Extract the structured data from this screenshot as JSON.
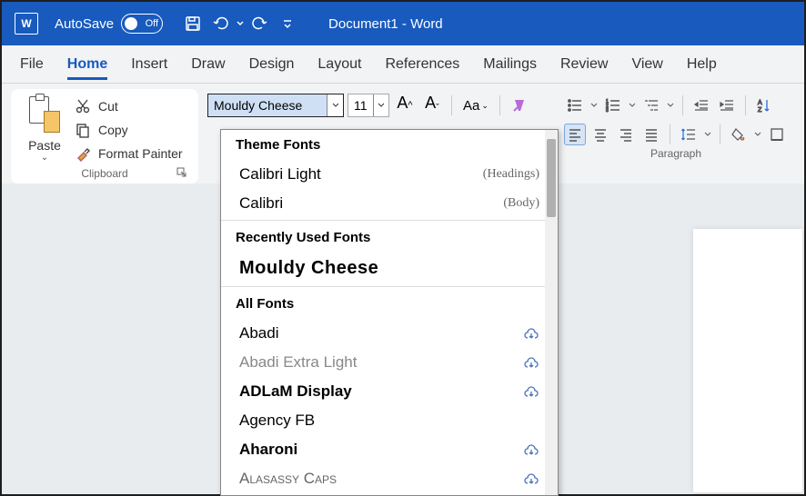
{
  "titlebar": {
    "autosave_label": "AutoSave",
    "autosave_state": "Off",
    "document_title": "Document1  -  Word"
  },
  "tabs": [
    "File",
    "Home",
    "Insert",
    "Draw",
    "Design",
    "Layout",
    "References",
    "Mailings",
    "Review",
    "View",
    "Help"
  ],
  "active_tab": "Home",
  "clipboard": {
    "paste_label": "Paste",
    "cut_label": "Cut",
    "copy_label": "Copy",
    "format_painter_label": "Format Painter",
    "group_label": "Clipboard"
  },
  "font": {
    "current_font": "Mouldy Cheese",
    "current_size": "11",
    "case_label": "Aa"
  },
  "paragraph": {
    "group_label": "Paragraph"
  },
  "font_dropdown": {
    "section_theme": "Theme Fonts",
    "theme_fonts": [
      {
        "name": "Calibri Light",
        "role": "(Headings)"
      },
      {
        "name": "Calibri",
        "role": "(Body)"
      }
    ],
    "section_recent": "Recently Used Fonts",
    "recent_fonts": [
      {
        "name": "Mouldy Cheese"
      }
    ],
    "section_all": "All Fonts",
    "all_fonts": [
      {
        "name": "Abadi",
        "cloud": true
      },
      {
        "name": "Abadi Extra Light",
        "cloud": true
      },
      {
        "name": "ADLaM Display",
        "cloud": true
      },
      {
        "name": "Agency FB"
      },
      {
        "name": "Aharoni",
        "cloud": true
      },
      {
        "name": "Alasassy Caps",
        "cloud": true
      }
    ]
  }
}
